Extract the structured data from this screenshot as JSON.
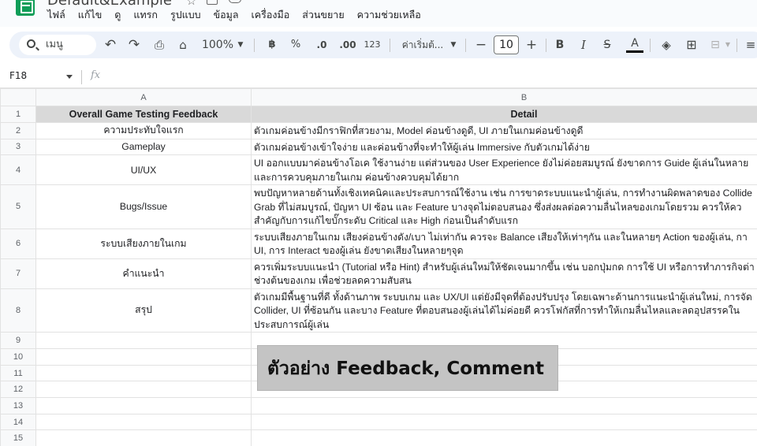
{
  "app": {
    "title": "Default&Example",
    "menu": [
      "ไฟล์",
      "แก้ไข",
      "ดู",
      "แทรก",
      "รูปแบบ",
      "ข้อมูล",
      "เครื่องมือ",
      "ส่วนขยาย",
      "ความช่วยเหลือ"
    ]
  },
  "toolbar": {
    "search_label": "เมนู",
    "zoom": "100%",
    "currency": "฿",
    "percent": "%",
    "decrease_decimal": ".0",
    "increase_decimal": ".00",
    "number_format": "123",
    "font": "ค่าเริ่มต้...",
    "font_size": "10",
    "minus": "−",
    "plus": "+",
    "bold": "B",
    "italic": "I",
    "strike": "S",
    "text_color_letter": "A"
  },
  "formula_bar": {
    "cell_ref": "F18",
    "fx": "fx"
  },
  "sheet": {
    "column_headers": [
      "A",
      "B"
    ],
    "row_numbers": [
      "1",
      "2",
      "3",
      "4",
      "5",
      "6",
      "7",
      "8",
      "9",
      "10",
      "11",
      "12",
      "13",
      "14",
      "15",
      "16"
    ],
    "header_row": {
      "a": "Overall Game Testing Feedback",
      "b": "Detail"
    },
    "rows": [
      {
        "a": "ความประทับใจแรก",
        "b": [
          "ตัวเกมค่อนข้างมีกราฟิกที่สวยงาม, Model ค่อนข้างดูดี, UI ภายในเกมค่อนข้างดูดี"
        ]
      },
      {
        "a": "Gameplay",
        "b": [
          "ตัวเกมค่อนข้างเข้าใจง่าย และค่อนข้างที่จะทำให้ผู้เล่น Immersive กับตัวเกมได้ง่าย"
        ]
      },
      {
        "a": "UI/UX",
        "b": [
          "UI ออกแบบมาค่อนข้างโอเค ใช้งานง่าย แต่ส่วนของ User Experience ยังไม่ค่อยสมบูรณ์ ยังขาดการ Guide ผู้เล่นในหลาย",
          "และการควบคุมภายในเกม ค่อนข้างควบคุมได้ยาก"
        ]
      },
      {
        "a": "Bugs/Issue",
        "b": [
          "พบปัญหาหลายด้านทั้งเชิงเทคนิคและประสบการณ์ใช้งาน เช่น การขาดระบบแนะนำผู้เล่น, การทำงานผิดพลาดของ Collide",
          "Grab ที่ไม่สมบูรณ์, ปัญหา UI ซ้อน และ Feature บางจุดไม่ตอบสนอง ซึ่งส่งผลต่อความลื่นไหลของเกมโดยรวม ควรให้คว",
          "สำคัญกับการแก้ไขบั๊กระดับ Critical และ High ก่อนเป็นลำดับแรก"
        ]
      },
      {
        "a": "ระบบเสียงภายในเกม",
        "b": [
          "ระบบเสียงภายในเกม เสียงค่อนข้างดัง/เบา ไม่เท่ากัน ควรจะ Balance เสียงให้เท่าๆกัน และในหลายๆ Action ของผู้เล่น, กา",
          "UI, การ Interact ของผู้เล่น ยังขาดเสียงในหลายๆจุด"
        ]
      },
      {
        "a": "คำแนะนำ",
        "b": [
          "ควรเพิ่มระบบแนะนำ (Tutorial หรือ Hint) สำหรับผู้เล่นใหม่ให้ชัดเจนมากขึ้น เช่น บอกปุ่มกด การใช้ UI หรือการทำภารกิจต่า",
          "ช่วงต้นของเกม เพื่อช่วยลดความสับสน"
        ]
      },
      {
        "a": "สรุป",
        "b": [
          "ตัวเกมมีพื้นฐานที่ดี ทั้งด้านภาพ ระบบเกม และ UX/UI แต่ยังมีจุดที่ต้องปรับปรุง โดยเฉพาะด้านการแนะนำผู้เล่นใหม่, การจัด",
          "Collider, UI ที่ซ้อนกัน และบาง Feature ที่ตอบสนองผู้เล่นได้ไม่ค่อยดี ควรโฟกัสที่การทำให้เกมลื่นไหลและลดอุปสรรคใน",
          "ประสบการณ์ผู้เล่น"
        ]
      }
    ]
  },
  "overlay": {
    "caption": "ตัวอย่าง Feedback, Comment"
  }
}
